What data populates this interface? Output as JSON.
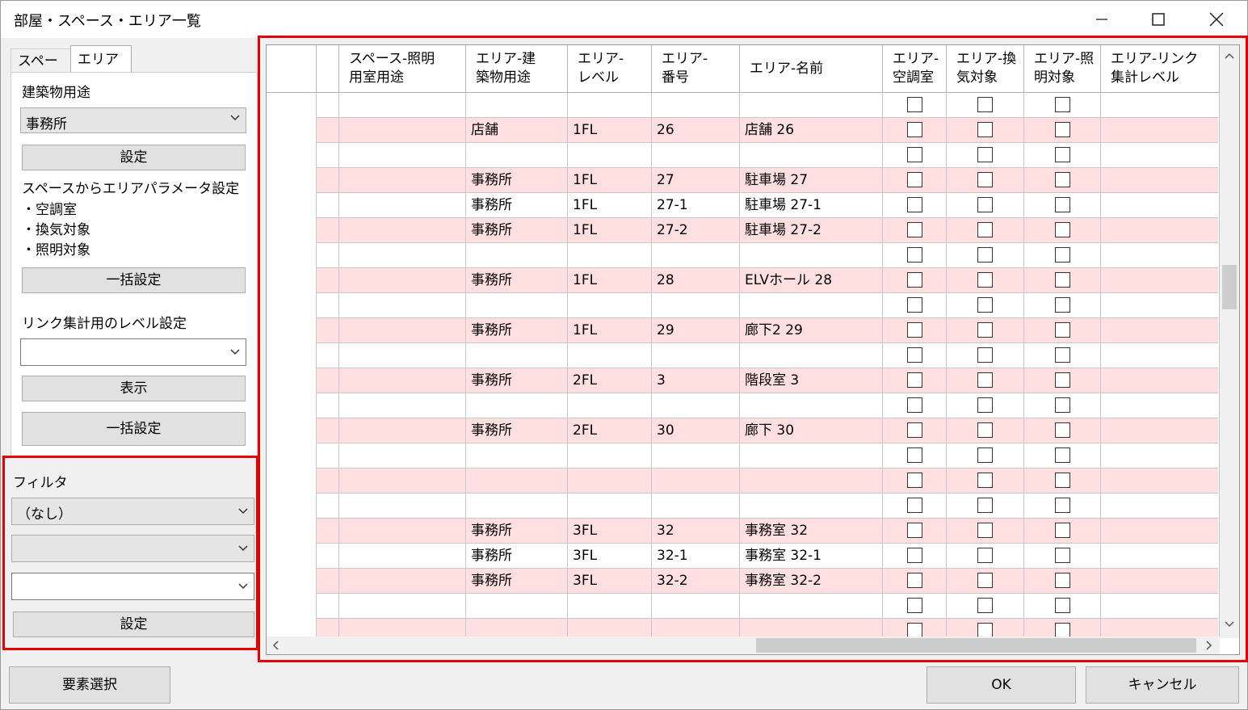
{
  "window": {
    "title": "部屋・スペース・エリア一覧",
    "minimize": "—",
    "maximize": "☐",
    "close": "✕"
  },
  "tabs": [
    {
      "label": "スペース"
    },
    {
      "label": "エリア"
    }
  ],
  "area_tab": {
    "building_use_label": "建築物用途",
    "building_use_value": "事務所",
    "set_button": "設定",
    "param_heading": "スペースからエリアパラメータ設定",
    "param_items": [
      "・空調室",
      "・換気対象",
      "・照明対象"
    ],
    "bulk_button_1": "一括設定",
    "link_level_label": "リンク集計用のレベル設定",
    "link_level_value": "",
    "show_button": "表示",
    "bulk_button_2": "一括設定"
  },
  "filter": {
    "label": "フィルタ",
    "combo1_value": "（なし）",
    "combo2_value": "",
    "combo3_value": "",
    "set_button": "設定"
  },
  "grid": {
    "columns": [
      "",
      "スペース-照明\n用室用途",
      "エリア-建\n築物用途",
      "エリア-\nレベル",
      "エリア-\n番号",
      "エリア-名前",
      "エリア-\n空調室",
      "エリア-換\n気対象",
      "エリア-照\n明対象",
      "エリア-リンク\n集計レベル"
    ],
    "rows": [
      {
        "use": "",
        "level": "",
        "num": "",
        "name": "",
        "pink": false
      },
      {
        "use": "店舗",
        "level": "1FL",
        "num": "26",
        "name": "店舗 26",
        "pink": true
      },
      {
        "use": "",
        "level": "",
        "num": "",
        "name": "",
        "pink": false
      },
      {
        "use": "事務所",
        "level": "1FL",
        "num": "27",
        "name": "駐車場 27",
        "pink": true
      },
      {
        "use": "事務所",
        "level": "1FL",
        "num": "27-1",
        "name": "駐車場 27-1",
        "pink": false
      },
      {
        "use": "事務所",
        "level": "1FL",
        "num": "27-2",
        "name": "駐車場 27-2",
        "pink": true
      },
      {
        "use": "",
        "level": "",
        "num": "",
        "name": "",
        "pink": false
      },
      {
        "use": "事務所",
        "level": "1FL",
        "num": "28",
        "name": "ELVホール 28",
        "pink": true
      },
      {
        "use": "",
        "level": "",
        "num": "",
        "name": "",
        "pink": false
      },
      {
        "use": "事務所",
        "level": "1FL",
        "num": "29",
        "name": "廊下2 29",
        "pink": true
      },
      {
        "use": "",
        "level": "",
        "num": "",
        "name": "",
        "pink": false
      },
      {
        "use": "事務所",
        "level": "2FL",
        "num": "3",
        "name": "階段室 3",
        "pink": true
      },
      {
        "use": "",
        "level": "",
        "num": "",
        "name": "",
        "pink": false
      },
      {
        "use": "事務所",
        "level": "2FL",
        "num": "30",
        "name": "廊下 30",
        "pink": true
      },
      {
        "use": "",
        "level": "",
        "num": "",
        "name": "",
        "pink": false
      },
      {
        "use": "",
        "level": "",
        "num": "",
        "name": "",
        "pink": true
      },
      {
        "use": "",
        "level": "",
        "num": "",
        "name": "",
        "pink": false
      },
      {
        "use": "事務所",
        "level": "3FL",
        "num": "32",
        "name": "事務室 32",
        "pink": true
      },
      {
        "use": "事務所",
        "level": "3FL",
        "num": "32-1",
        "name": "事務室 32-1",
        "pink": false
      },
      {
        "use": "事務所",
        "level": "3FL",
        "num": "32-2",
        "name": "事務室 32-2",
        "pink": true
      },
      {
        "use": "",
        "level": "",
        "num": "",
        "name": "",
        "pink": false
      },
      {
        "use": "",
        "level": "",
        "num": "",
        "name": "",
        "pink": true
      }
    ]
  },
  "footer": {
    "select_button": "要素選択",
    "ok_button": "OK",
    "cancel_button": "キャンセル"
  },
  "colors": {
    "highlight_box": "#e60000",
    "row_pink": "#ffdfdf"
  }
}
